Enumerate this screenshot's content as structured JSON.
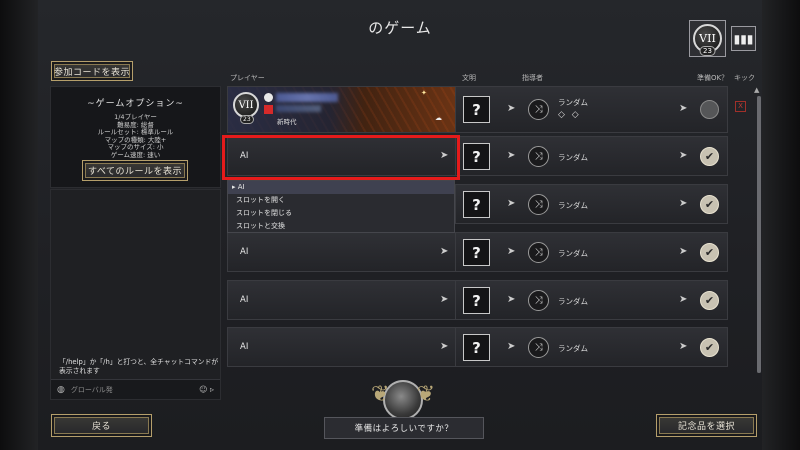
{
  "window": {
    "title": "のゲーム"
  },
  "top": {
    "invite_code_label": "参加コードを表示",
    "era_badge": {
      "numeral": "VII",
      "level": "23"
    },
    "roster_icon": "roster-icon"
  },
  "options": {
    "title": "~ゲームオプション~",
    "lines": [
      "1/4プレイヤー",
      "難易度: 総督",
      "ルールセット: 標準ルール",
      "マップの種類: 大陸+",
      "マップのサイズ: 小",
      "ゲーム速度: 速い"
    ],
    "all_rules_label": "すべてのルールを表示"
  },
  "chat": {
    "message": "「/help」か「/h」と打つと、全チャットコマンドが表示されます",
    "input_placeholder": "グローバル発"
  },
  "table": {
    "headers": {
      "player": "プレイヤー",
      "civ": "文明",
      "leader": "指導者",
      "ready": "準備OK？",
      "kick": "キック"
    },
    "human": {
      "numeral": "VII",
      "level": "23",
      "era_name": "新時代",
      "civ": "?",
      "leader": "ランダム",
      "leader_sub": "◇ ◇",
      "kick": "X"
    },
    "ai_rows": [
      {
        "label": "AI",
        "civ": "?",
        "leader": "ランダム",
        "ready": "✔"
      },
      {
        "label": "AI",
        "civ": "?",
        "leader": "ランダム",
        "ready": "✔"
      },
      {
        "label": "AI",
        "civ": "?",
        "leader": "ランダム",
        "ready": "✔"
      },
      {
        "label": "AI",
        "civ": "?",
        "leader": "ランダム",
        "ready": "✔"
      },
      {
        "label": "AI",
        "civ": "?",
        "leader": "ランダム",
        "ready": "✔"
      }
    ]
  },
  "dropdown": {
    "options": [
      "AI",
      "スロットを開く",
      "スロットを閉じる",
      "スロットと交換"
    ],
    "selected": "AI"
  },
  "bottom": {
    "back_label": "戻る",
    "ready_prompt": "準備はよろしいですか？",
    "memento_label": "記念品を選択"
  }
}
